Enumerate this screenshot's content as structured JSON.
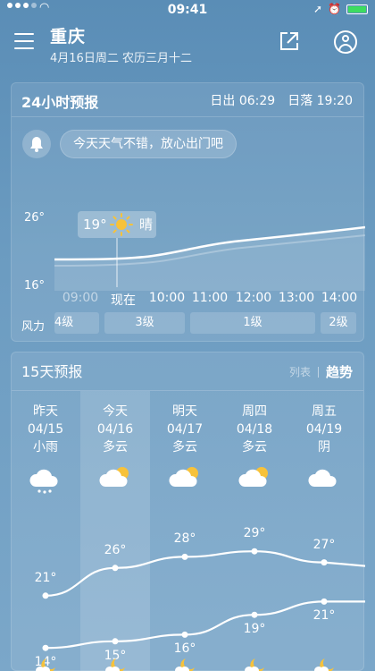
{
  "status_bar": {
    "time": "09:41"
  },
  "header": {
    "city": "重庆",
    "date": "4月16日周二 农历三月十二"
  },
  "hourly": {
    "title": "24小时预报",
    "sunrise": "日出 06:29",
    "sunset": "日落 19:20",
    "tip": "今天天气不错，放心出门吧",
    "axis_high": "26°",
    "axis_low": "16°",
    "current": {
      "temp": "19°",
      "condition": "晴"
    },
    "hours": [
      "09:00",
      "现在",
      "10:00",
      "11:00",
      "12:00",
      "13:00",
      "14:00"
    ],
    "wind_title": "风力",
    "wind": [
      "4级",
      "3级",
      "1级",
      "2级"
    ]
  },
  "forecast": {
    "title": "15天预报",
    "view_list": "列表",
    "view_trend": "趋势",
    "days": [
      {
        "day": "昨天",
        "date": "04/15",
        "cond": "小雨",
        "high": "21°",
        "low": "14°",
        "icon": "rain-cloud-icon"
      },
      {
        "day": "今天",
        "date": "04/16",
        "cond": "多云",
        "high": "26°",
        "low": "15°",
        "icon": "partly-cloudy-icon"
      },
      {
        "day": "明天",
        "date": "04/17",
        "cond": "多云",
        "high": "28°",
        "low": "16°",
        "icon": "partly-cloudy-icon"
      },
      {
        "day": "周四",
        "date": "04/18",
        "cond": "多云",
        "high": "29°",
        "low": "19°",
        "icon": "partly-cloudy-icon"
      },
      {
        "day": "周五",
        "date": "04/19",
        "cond": "阴",
        "high": "27°",
        "low": "21°",
        "icon": "cloud-icon"
      }
    ]
  },
  "chart_data": {
    "type": "line",
    "x": [
      "昨天",
      "今天",
      "明天",
      "周四",
      "周五"
    ],
    "series": [
      {
        "values": [
          21,
          26,
          28,
          29,
          27
        ]
      },
      {
        "values": [
          14,
          15,
          16,
          19,
          21
        ]
      }
    ]
  }
}
